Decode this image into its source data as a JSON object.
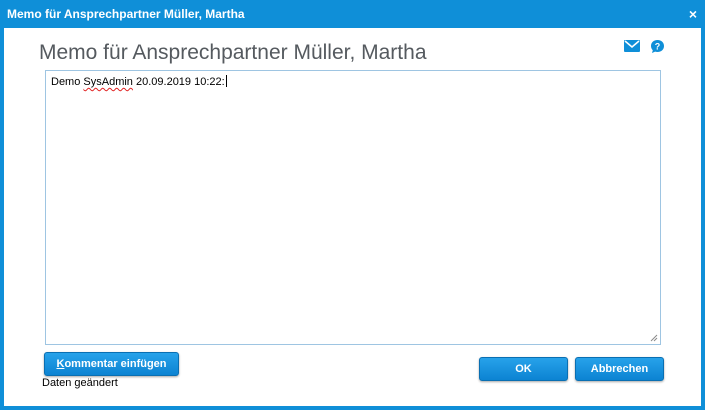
{
  "window": {
    "title": "Memo für Ansprechpartner Müller, Martha",
    "close_glyph": "×"
  },
  "header": {
    "heading": "Memo für Ansprechpartner Müller, Martha",
    "icons": [
      "mail-icon",
      "help-icon"
    ]
  },
  "memo": {
    "text_prefix": "Demo ",
    "text_misspelled": "SysAdmin",
    "text_suffix": " 20.09.2019 10:22:"
  },
  "buttons": {
    "comment_accesskey": "K",
    "comment_rest": "ommentar einfügen",
    "ok": "OK",
    "cancel": "Abbrechen"
  },
  "status": "Daten geändert",
  "colors": {
    "accent": "#0f8fd8",
    "button_top": "#27a2ea",
    "button_bottom": "#0c83d2",
    "heading_text": "#555a5f",
    "memo_border": "#9ec5e2"
  }
}
